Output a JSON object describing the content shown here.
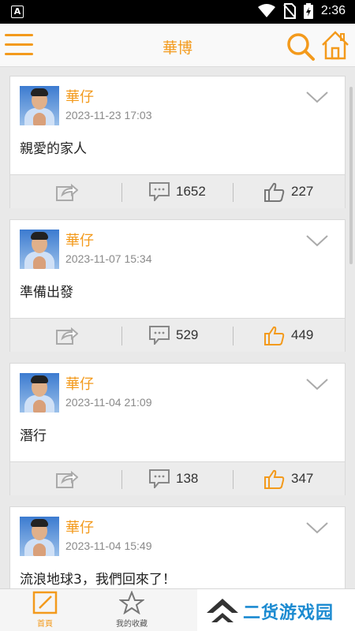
{
  "status_bar": {
    "time": "2:36",
    "left_icon": "A"
  },
  "app_bar": {
    "title": "華博"
  },
  "posts": [
    {
      "author": "華仔",
      "date": "2023-11-23 17:03",
      "text": "親愛的家人",
      "comments": "1652",
      "likes": "227",
      "liked": false
    },
    {
      "author": "華仔",
      "date": "2023-11-07 15:34",
      "text": "準備出發",
      "comments": "529",
      "likes": "449",
      "liked": true
    },
    {
      "author": "華仔",
      "date": "2023-11-04 21:09",
      "text": "潛行",
      "comments": "138",
      "likes": "347",
      "liked": true
    },
    {
      "author": "華仔",
      "date": "2023-11-04 15:49",
      "text": "流浪地球3，我們回來了！",
      "comments": "",
      "likes": "",
      "liked": false
    }
  ],
  "tab_bar": {
    "home_label": "首頁",
    "favorites_label": "我的收藏",
    "watermark": "二货游戏园"
  },
  "colors": {
    "accent": "#f39a1c",
    "watermark": "#1c8bd1"
  }
}
